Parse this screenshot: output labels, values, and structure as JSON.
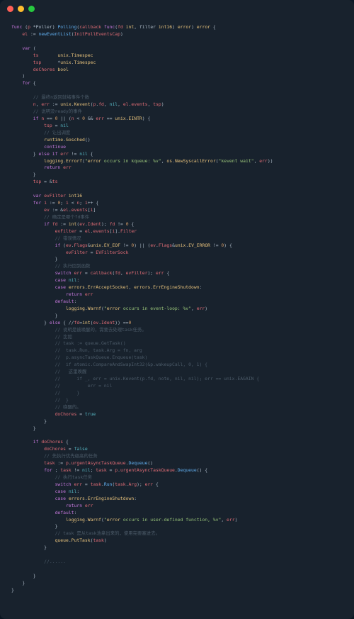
{
  "window": {
    "title": ""
  },
  "traffic": {
    "red": "#ff5f56",
    "yellow": "#ffbd2e",
    "green": "#27c93f"
  },
  "code": {
    "lines": [
      "func (p *Poller) Polling(callback func(fd int, filter int16) error) error {",
      "    el := newEventList(InitPollEventsCap)",
      "",
      "    var (",
      "        ts       unix.Timespec",
      "        tsp      *unix.Timespec",
      "        doChores bool",
      "    )",
      "    for {",
      "",
      "        // 最终n返回就绪事件个数",
      "        n, err := unix.Kevent(p.fd, nil, el.events, tsp)",
      "        // 说明没ready的事件",
      "        if n == 0 || (n < 0 && err == unix.EINTR) {",
      "            tsp = nil",
      "            // 让出调度",
      "            runtime.Gosched()",
      "            continue",
      "        } else if err != nil {",
      "            logging.Errorf(\"error occurs in kqueue: %v\", os.NewSyscallError(\"kevent wait\", err))",
      "            return err",
      "        }",
      "        tsp = &ts",
      "",
      "        var evFilter int16",
      "        for i := 0; i < n; i++ {",
      "            ev := &el.events[i]",
      "            // 确定是哪个fd事件",
      "            if fd := int(ev.Ident); fd != 0 {",
      "                evFilter = el.events[i].Filter",
      "                // 错误情况",
      "                if (ev.Flags&unix.EV_EOF != 0) || (ev.Flags&unix.EV_ERROR != 0) {",
      "                    evFilter = EVFilterSock",
      "                }",
      "                // 执行回到函数",
      "                switch err = callback(fd, evFilter); err {",
      "                case nil:",
      "                case errors.ErrAcceptSocket, errors.ErrEngineShutdown:",
      "                    return err",
      "                default:",
      "                    logging.Warnf(\"error occurs in event-loop: %v\", err)",
      "                }",
      "            } else { //fd=int(ev.Ident)) ==0",
      "                // 说明是被唤醒的，需要去处理task任务。",
      "                // 比如",
      "                // task := queue.GetTask()",
      "                //  task.Run, task.Arg = fn, arg",
      "                //  p.asyncTaskQueue.Enqueue(task)",
      "                //  if atomic.CompareAndSwapInt32(&p.wakeupCall, 0, 1) {",
      "                //   这里唤醒",
      "                //      if _, err = unix.Kevent(p.fd, note, nil, nil); err == unix.EAGAIN {",
      "                //          err = nil",
      "                //      }",
      "                //  }",
      "                // 唤醒的。",
      "                doChores = true",
      "            }",
      "        }",
      "",
      "        if doChores {",
      "            doChores = false",
      "            // 先执行优先级高的任务",
      "            task := p.urgentAsyncTaskQueue.Dequeue()",
      "            for ; task != nil; task = p.urgentAsyncTaskQueue.Dequeue() {",
      "                // 执行task任务",
      "                switch err = task.Run(task.Arg); err {",
      "                case nil:",
      "                case errors.ErrEngineShutdown:",
      "                    return err",
      "                default:",
      "                    logging.Warnf(\"error occurs in user-defined function, %v\", err)",
      "                }",
      "                // task 是从task池拿出来的，使用完要塞进去。",
      "                queue.PutTask(task)",
      "            }",
      "",
      "            //......",
      "",
      "        }",
      "    }",
      "}"
    ]
  }
}
